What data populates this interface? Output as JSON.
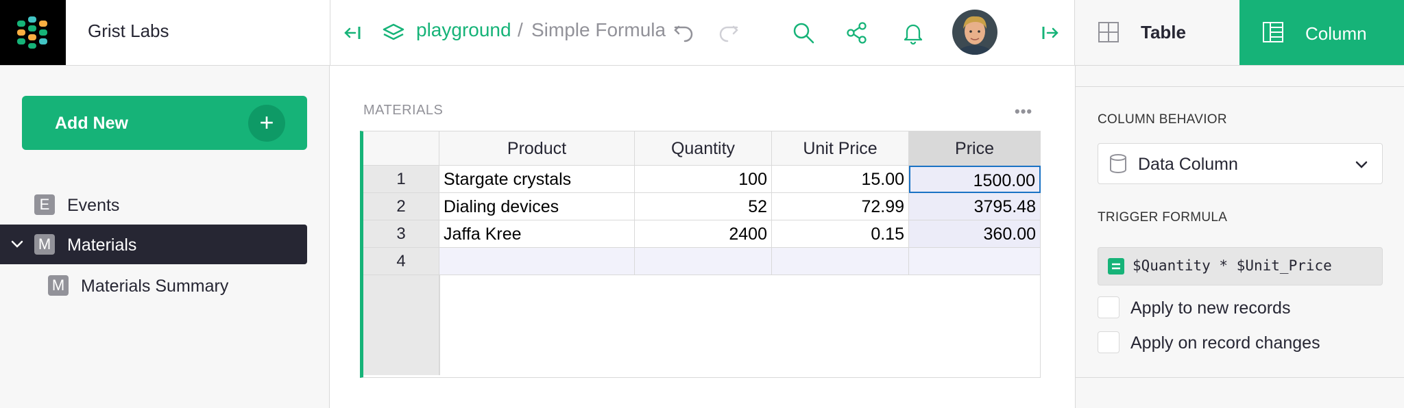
{
  "org": {
    "name": "Grist Labs"
  },
  "breadcrumb": {
    "doc": "playground",
    "separator": "/",
    "page": "Simple Formula"
  },
  "right_tabs": {
    "table": "Table",
    "column": "Column"
  },
  "sidebar": {
    "add_new": "Add New",
    "pages": [
      {
        "badge": "E",
        "name": "Events",
        "active": false,
        "expanded": false
      },
      {
        "badge": "M",
        "name": "Materials",
        "active": true,
        "expanded": true
      },
      {
        "badge": "M",
        "name": "Materials Summary",
        "active": false
      }
    ]
  },
  "section": {
    "title": "MATERIALS",
    "menu": "•••"
  },
  "grid": {
    "columns": [
      "Product",
      "Quantity",
      "Unit Price",
      "Price"
    ],
    "selected_column": "Price",
    "rows": [
      {
        "n": "1",
        "cells": [
          "Stargate crystals",
          "100",
          "15.00",
          "1500.00"
        ]
      },
      {
        "n": "2",
        "cells": [
          "Dialing devices",
          "52",
          "72.99",
          "3795.48"
        ]
      },
      {
        "n": "3",
        "cells": [
          "Jaffa Kree",
          "2400",
          "0.15",
          "360.00"
        ]
      },
      {
        "n": "4",
        "cells": [
          "",
          "",
          "",
          ""
        ]
      }
    ]
  },
  "column_panel": {
    "behavior_title": "COLUMN BEHAVIOR",
    "behavior_value": "Data Column",
    "trigger_title": "TRIGGER FORMULA",
    "formula": "$Quantity * $Unit_Price",
    "apply_new": "Apply to new records",
    "apply_changes": "Apply on record changes"
  },
  "colors": {
    "accent": "#16b378",
    "dark": "#262633",
    "cursor": "#1a72c4"
  }
}
